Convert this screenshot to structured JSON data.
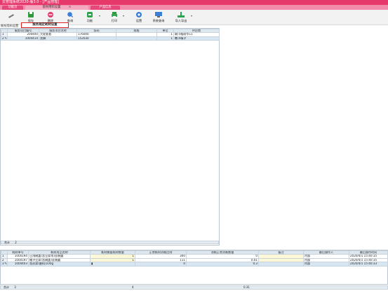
{
  "window": {
    "title": "云管理系统2020-版3.0 - [产品管理]"
  },
  "tabs": [
    {
      "label": "功能页",
      "active": false
    },
    {
      "label": "套材用料设置",
      "active": true,
      "close": "×"
    },
    {
      "label": "产品信息",
      "active": false
    }
  ],
  "toolbar": {
    "buttons": [
      {
        "label": "",
        "icon": "pencil-icon"
      },
      {
        "label": "保存",
        "icon": "save-icon"
      },
      {
        "label": "删除",
        "icon": "delete-icon"
      },
      {
        "label": "查询",
        "icon": "search-icon"
      },
      {
        "label": "功能",
        "icon": "function-icon"
      },
      {
        "label": "打印",
        "icon": "print-icon"
      },
      {
        "label": "设置",
        "icon": "settings-icon"
      },
      {
        "label": "系统查询",
        "icon": "system-query-icon"
      },
      {
        "label": "导入导出",
        "icon": "import-export-icon"
      }
    ]
  },
  "upper": {
    "section_label": "耗材用料设置",
    "highlight_button": "服务规定耗材设置",
    "columns": [
      "服务项目编号",
      "服务项目名称",
      "条码",
      "规格",
      "单位",
      "供应商"
    ],
    "rows": [
      {
        "no": "1",
        "code": "200400",
        "name": "大轮套套",
        "barcode": "176000",
        "spec": "",
        "unit": "1",
        "supplier": "联川格耐华11"
      },
      {
        "no": "2",
        "code": "1004414",
        "name": "洗脚",
        "barcode": "152030",
        "spec": "",
        "unit": "1",
        "supplier": "瞧子精子"
      }
    ],
    "footer": {
      "label": "合计",
      "count": "2"
    }
  },
  "lower": {
    "columns": [
      "耗材单号",
      "耗材用品名称",
      "耗材需要耗材数量",
      "正常耗材消耗比例",
      "消耗正常消耗数量",
      "备注",
      "最后操作人",
      "最后操作时间"
    ],
    "rows": [
      {
        "no": "1",
        "code": "1000194",
        "name": "日浅碗盖(含豆浆等)去装圆",
        "qty": "1",
        "ratio": "300",
        "consume": "0",
        "note": "",
        "operator": "内部",
        "time": "2020/4/1 15:40:15"
      },
      {
        "no": "2",
        "code": "1000197",
        "name": "橘子豆浆(含碗盖)去装圆",
        "qty": "1",
        "ratio": "111",
        "consume": "0.01",
        "note": "",
        "operator": "内部",
        "time": "2020/4/1 15:40:35"
      },
      {
        "no": "3",
        "code": "1004403",
        "name": "花药浆(磨料)100g",
        "qty": "",
        "ratio": "0",
        "consume": "0.3",
        "note": "",
        "operator": "内部",
        "time": "2020/4/1 15:40:33"
      }
    ],
    "footer": {
      "label": "合计",
      "count": "3",
      "qty_total": "4",
      "consume_total": "0.31"
    }
  },
  "colors": {
    "brand": "#e6396a",
    "tab_bar": "#f38aa9",
    "grid_header": "#dde7f0",
    "selected_row": "#d7e6f3",
    "highlight": "#d22222"
  }
}
